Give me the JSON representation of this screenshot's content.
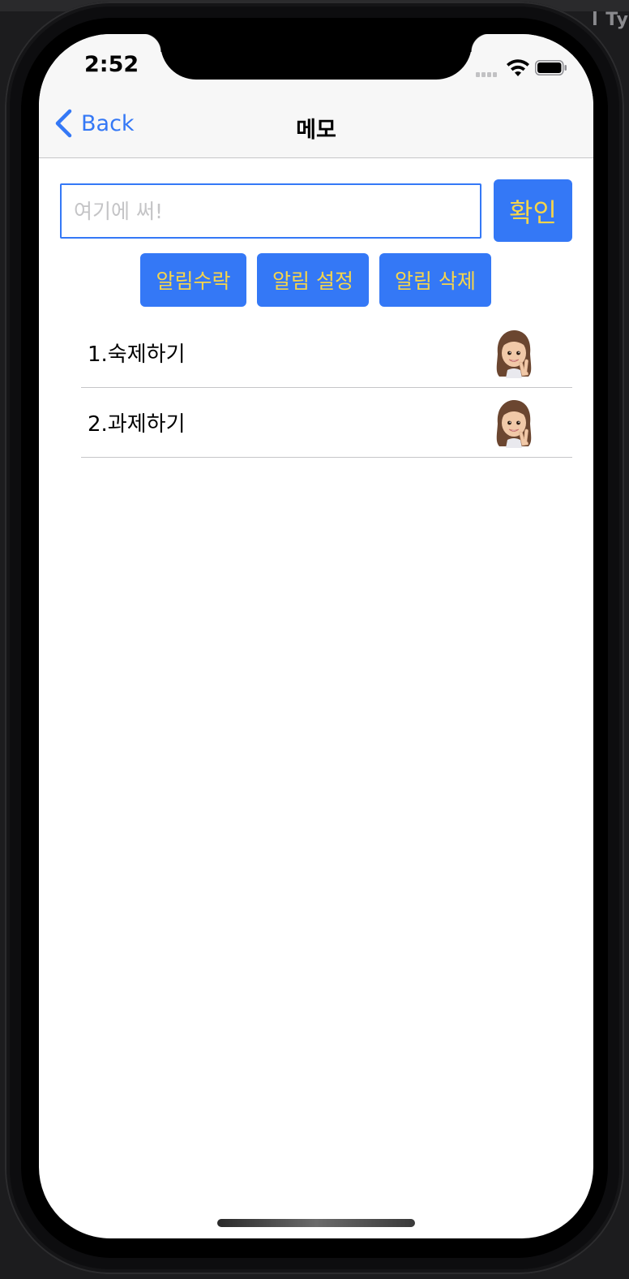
{
  "status_bar": {
    "time": "2:52",
    "signal_icon": "cellular-signal-icon",
    "wifi_icon": "wifi-icon",
    "battery_icon": "battery-full-icon"
  },
  "nav": {
    "back_label": "Back",
    "back_icon": "chevron-left-icon",
    "title": "메모"
  },
  "memo_input": {
    "value": "",
    "placeholder": "여기에 써!"
  },
  "buttons": {
    "confirm": "확인",
    "alarm_accept": "알림수락",
    "alarm_set": "알림 설정",
    "alarm_delete": "알림 삭제"
  },
  "memos": [
    {
      "label": "1.숙제하기",
      "icon": "memoji-peace-sign-icon"
    },
    {
      "label": "2.과제하기",
      "icon": "memoji-peace-sign-icon"
    }
  ],
  "desktop_text": "l Ty",
  "colors": {
    "accent": "#3478f6",
    "button_text": "#f7d54a",
    "nav_background": "#f7f7f7"
  }
}
